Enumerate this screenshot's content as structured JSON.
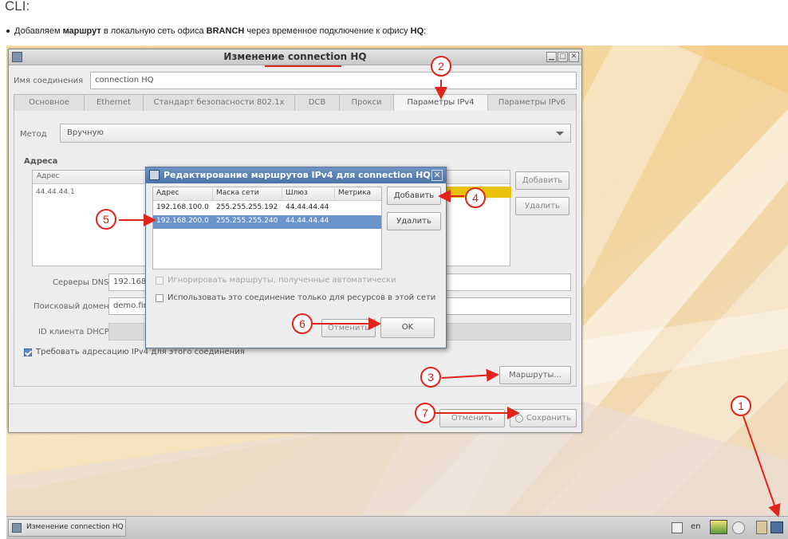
{
  "doc": {
    "heading": "CLI:",
    "bullet_parts": [
      "Добавляем ",
      "маршрут",
      " в локальную сеть офиса ",
      "BRANCH",
      " через временное подключение к офису ",
      "HQ",
      ":"
    ]
  },
  "window": {
    "title": "Изменение connection HQ",
    "name_label": "Имя соединения",
    "name_value": "connection HQ",
    "tabs": [
      "Основное",
      "Ethernet",
      "Стандарт безопасности 802.1x",
      "DCB",
      "Прокси",
      "Параметры IPv4",
      "Параметры IPv6"
    ],
    "active_tab": "Параметры IPv4",
    "method_label": "Метод",
    "method_value": "Вручную",
    "addresses_title": "Адреса",
    "addresses_col": "Адрес",
    "address_value": "44.44.44.1",
    "add_label": "Добавить",
    "delete_label": "Удалить",
    "dns_label": "Серверы DNS",
    "dns_value": "192.168.1",
    "search_label": "Поисковый домен",
    "search_value": "demo.firs",
    "dhcp_label": "ID клиента DHCP",
    "require_ipv4_label": "Требовать адресацию IPv4 для этого соединения",
    "require_ipv4_checked": true,
    "routes_button": "Маршруты...",
    "cancel_label": "Отменить",
    "save_label": "Сохранить"
  },
  "dialog": {
    "title": "Редактирование маршрутов IPv4 для connection HQ",
    "columns": [
      "Адрес",
      "Маска сети",
      "Шлюз",
      "Метрика"
    ],
    "routes": [
      {
        "address": "192.168.100.0",
        "mask": "255.255.255.192",
        "gateway": "44.44.44.44",
        "metric": ""
      },
      {
        "address": "192.168.200.0",
        "mask": "255.255.255.240",
        "gateway": "44.44.44.44",
        "metric": ""
      }
    ],
    "selected_row": 1,
    "add_label": "Добавить",
    "delete_label": "Удалить",
    "ignore_auto_label": "Игнорировать маршруты, полученные автоматически",
    "ignore_auto_checked": false,
    "only_local_label": "Использовать это соединение только для ресурсов в этой сети",
    "only_local_checked": false,
    "cancel_label": "Отменить",
    "ok_label": "OK"
  },
  "taskbar": {
    "task_label": "Изменение connection HQ",
    "lang": "en"
  },
  "callouts": [
    "1",
    "2",
    "3",
    "4",
    "5",
    "6",
    "7"
  ],
  "colors": {
    "accent_red": "#e2231a",
    "selection_blue": "#6a93cc",
    "dialog_title_blue": "#4b72a8",
    "address_highlight": "#e8c20a"
  }
}
